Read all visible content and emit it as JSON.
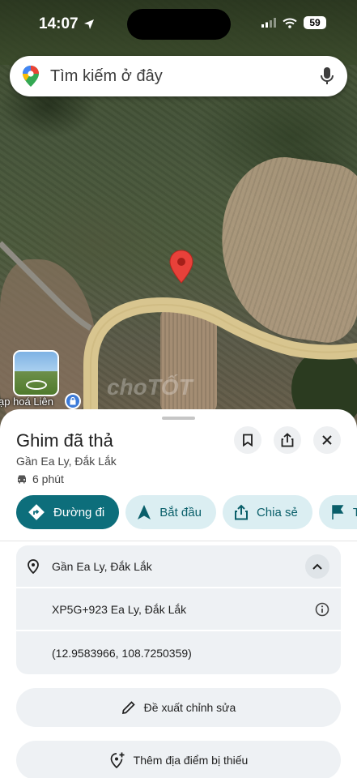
{
  "status_bar": {
    "time": "14:07",
    "battery": "59"
  },
  "search": {
    "placeholder": "Tìm kiếm ở đây"
  },
  "map": {
    "place_label": "ạp hoá Liên",
    "watermark": "choTỐT"
  },
  "place": {
    "title": "Ghim đã thả",
    "subtitle": "Gần Ea Ly, Đắk Lắk",
    "travel_time": "6 phút"
  },
  "actions": [
    {
      "label": "Đường đi",
      "icon": "directions-icon"
    },
    {
      "label": "Bắt đầu",
      "icon": "navigation-arrow-icon"
    },
    {
      "label": "Chia sẻ",
      "icon": "share-icon"
    },
    {
      "label": "T",
      "icon": "flag-icon"
    }
  ],
  "details": {
    "address": "Gần Ea Ly, Đắk Lắk",
    "plus_code": "XP5G+923 Ea Ly, Đắk Lắk",
    "coordinates": "(12.9583966, 108.7250359)"
  },
  "buttons": {
    "suggest_edit": "Đề xuất chỉnh sửa",
    "add_missing_place": "Thêm địa điểm bị thiếu"
  },
  "colors": {
    "primary": "#0d6e7b",
    "chip_bg": "#dbeef2",
    "pin": "#e8413a",
    "road": "#d8c58f"
  }
}
